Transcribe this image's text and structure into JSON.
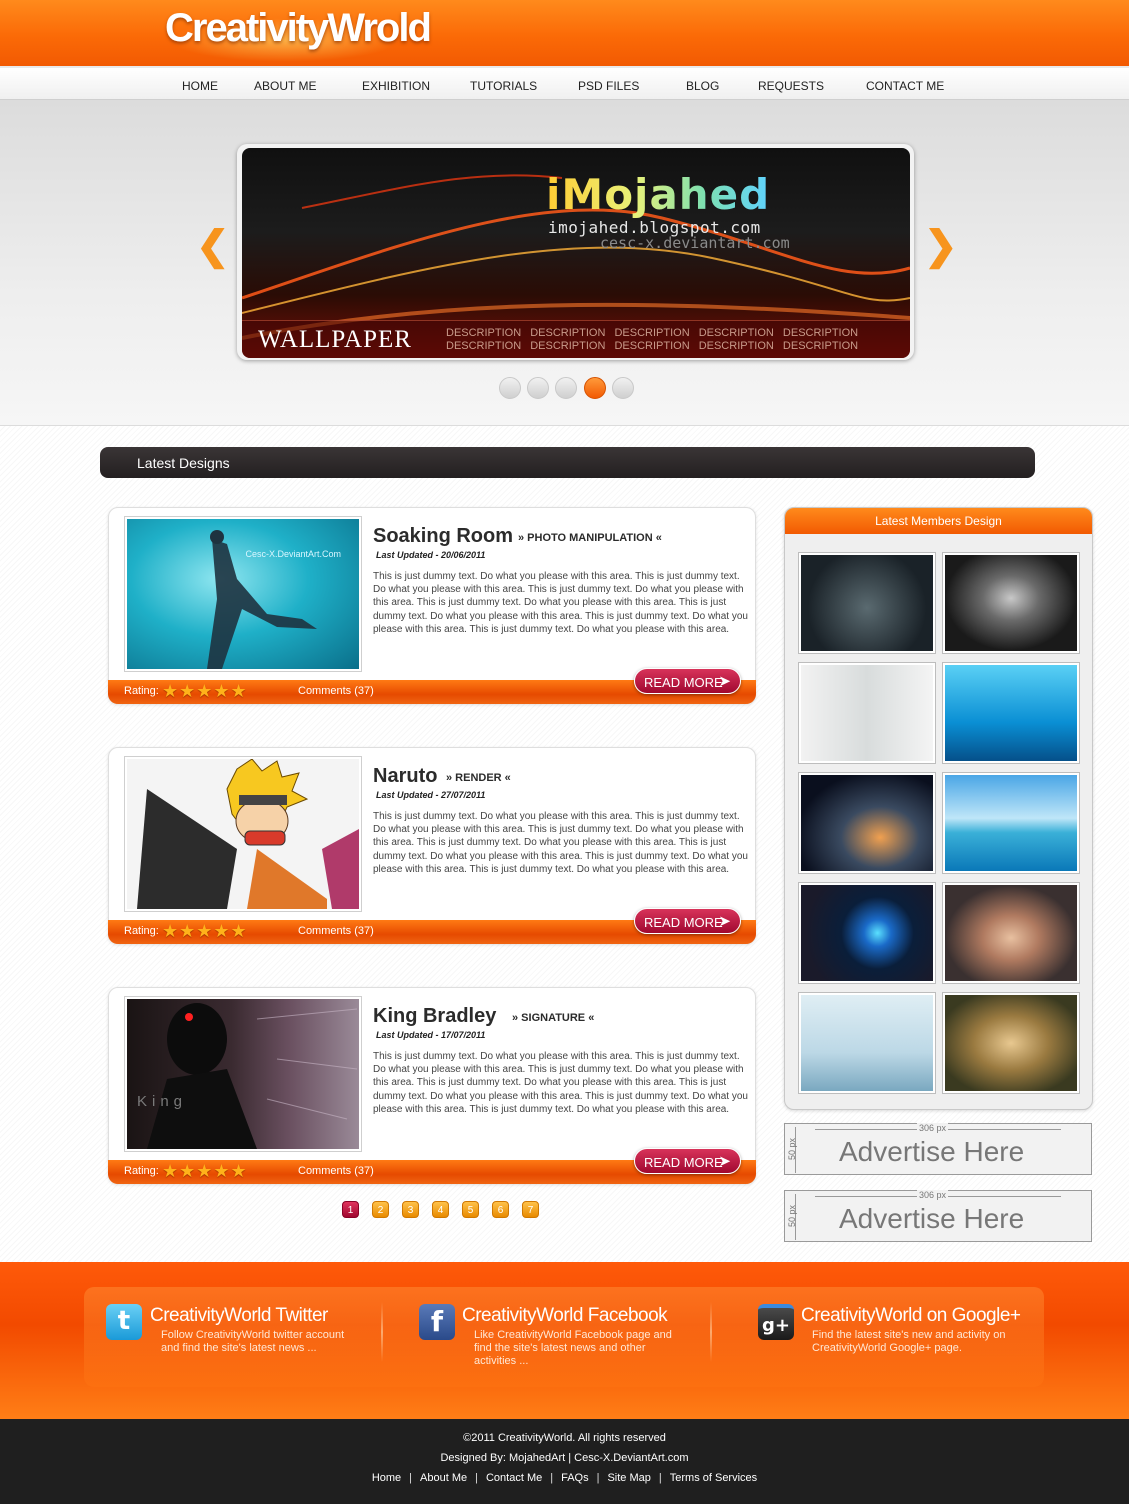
{
  "brand": {
    "logo": "CreativityWrold"
  },
  "nav": [
    "HOME",
    "ABOUT ME",
    "EXHIBITION",
    "TUTORIALS",
    "PSD FILES",
    "BLOG",
    "REQUESTS",
    "CONTACT ME"
  ],
  "slider": {
    "brand_big": "iMojahed",
    "url1": "imojahed.blogspot.com",
    "url2": "cesc-x.deviantart.com",
    "title": "WALLPAPER",
    "description": "DESCRIPTION DESCRIPTION DESCRIPTION DESCRIPTION DESCRIPTION DESCRIPTION DESCRIPTION DESCRIPTION DESCRIPTION DESCRIPTION",
    "prev_icon": "chevron-left-icon",
    "next_icon": "chevron-right-icon",
    "prev_glyph": "❮",
    "next_glyph": "❯",
    "dots_count": 5,
    "active_dot": 4
  },
  "latest_heading": "Latest Designs",
  "posts": [
    {
      "title": "Soaking Room",
      "category": "» PHOTO MANIPULATION «",
      "date": "Last Updated - 20/06/2011",
      "text": "This is just dummy text. Do what you please with this area. This is just dummy text. Do what you please with this area. This is just dummy text. Do what you please with this area. This is just dummy text. Do what you please with this area. This is just dummy text. Do what you please with this area. This is just dummy text. Do what you please with this area. This is just dummy text. Do what you please with this area.",
      "rating_label": "Rating:",
      "stars": "★★★★★",
      "comments": "Comments (37)",
      "read_more": "READ MORE",
      "read_more_glyph": "➤",
      "img_watermark": "Cesc-X.DeviantArt.Com"
    },
    {
      "title": "Naruto",
      "category": "» RENDER «",
      "date": "Last Updated - 27/07/2011",
      "text": "This is just dummy text. Do what you please with this area. This is just dummy text. Do what you please with this area. This is just dummy text. Do what you please with this area. This is just dummy text. Do what you please with this area. This is just dummy text. Do what you please with this area. This is just dummy text. Do what you please with this area. This is just dummy text. Do what you please with this area.",
      "rating_label": "Rating:",
      "stars": "★★★★★",
      "comments": "Comments (37)",
      "read_more": "READ MORE",
      "read_more_glyph": "➤"
    },
    {
      "title": "King Bradley",
      "category": "» SIGNATURE «",
      "date": "Last Updated - 17/07/2011",
      "text": "This is just dummy text. Do what you please with this area. This is just dummy text. Do what you please with this area. This is just dummy text. Do what you please with this area. This is just dummy text. Do what you please with this area. This is just dummy text. Do what you please with this area. This is just dummy text. Do what you please with this area. This is just dummy text. Do what you please with this area.",
      "rating_label": "Rating:",
      "stars": "★★★★★",
      "comments": "Comments (37)",
      "read_more": "READ MORE",
      "read_more_glyph": "➤",
      "img_text": "King"
    }
  ],
  "pagination": [
    "1",
    "2",
    "3",
    "4",
    "5",
    "6",
    "7"
  ],
  "members": {
    "title": "Latest Members Design",
    "count": 10
  },
  "ads": [
    {
      "px": "306 px",
      "side": "50 px",
      "text": "Advertise Here"
    },
    {
      "px": "306 px",
      "side": "50 px",
      "text": "Advertise Here"
    }
  ],
  "social": [
    {
      "title": "CreativityWorld Twitter",
      "desc": "Follow CreativityWorld twitter account and find the site's latest news ...",
      "icon": "twitter-icon",
      "glyph": "t",
      "color": "#3fb4e6"
    },
    {
      "title": "CreativityWorld Facebook",
      "desc": "Like CreativityWorld Facebook page and find the site's latest news and other activities ...",
      "icon": "facebook-icon",
      "glyph": "f",
      "color": "#3b5998"
    },
    {
      "title": "CreativityWorld on Google+",
      "desc": "Find the latest site's new and activity on CreativityWorld Google+ page.",
      "icon": "googleplus-icon",
      "glyph": "g+",
      "color": "#3a3a3a"
    }
  ],
  "footer": {
    "copyright": "©2011 CreativityWorld. All rights reserved",
    "designed_by": "Designed By: MojahedArt | Cesc-X.DeviantArt.com",
    "links": [
      "Home",
      "About Me",
      "Contact Me",
      "FAQs",
      "Site Map",
      "Terms of Services"
    ],
    "separator": "|"
  },
  "colors": {
    "accent": "#f25a02",
    "dark": "#231f20",
    "read_more": "#b8103c"
  }
}
